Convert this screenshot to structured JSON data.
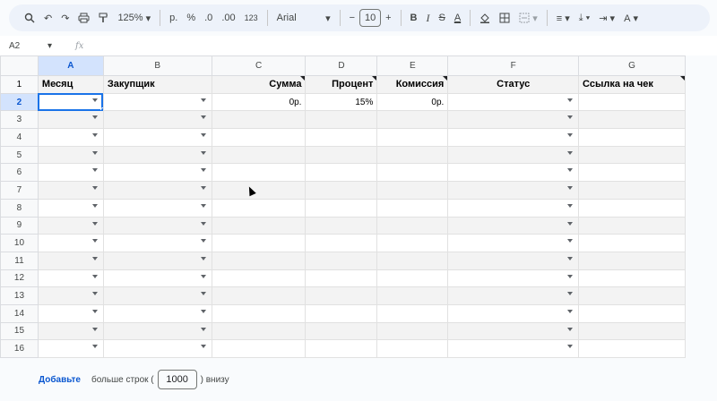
{
  "toolbar": {
    "zoom": "125%",
    "currency": "р.",
    "percent": "%",
    "dec_decrease": ".0",
    "dec_increase": ".00",
    "number_format": "123",
    "font": "Arial",
    "font_size": "10",
    "minus": "−",
    "plus": "+",
    "bold": "B",
    "italic": "I",
    "strike": "S",
    "text_color": "A"
  },
  "formula_bar": {
    "cell_ref": "A2",
    "fx": "fx"
  },
  "columns": [
    "A",
    "B",
    "C",
    "D",
    "E",
    "F",
    "G"
  ],
  "header_row": {
    "row_label": "1",
    "cells": [
      "Месяц",
      "Закупщик",
      "Сумма",
      "Процент",
      "Комиссия",
      "Статус",
      "Ссылка на чек"
    ]
  },
  "first_data_row": {
    "row_label": "2",
    "sum": "0р.",
    "percent": "15%",
    "commission": "0р."
  },
  "row_labels": [
    "3",
    "4",
    "5",
    "6",
    "7",
    "8",
    "9",
    "10",
    "11",
    "12",
    "13",
    "14",
    "15",
    "16"
  ],
  "footer": {
    "add_link": "Добавьте",
    "more_rows": "больше строк (",
    "rows_count": "1000",
    "below": ") внизу"
  },
  "colors": {
    "selection_blue": "#1a73e8",
    "band_gray": "#f3f3f3",
    "toolbar_bg": "#edf2fa"
  }
}
